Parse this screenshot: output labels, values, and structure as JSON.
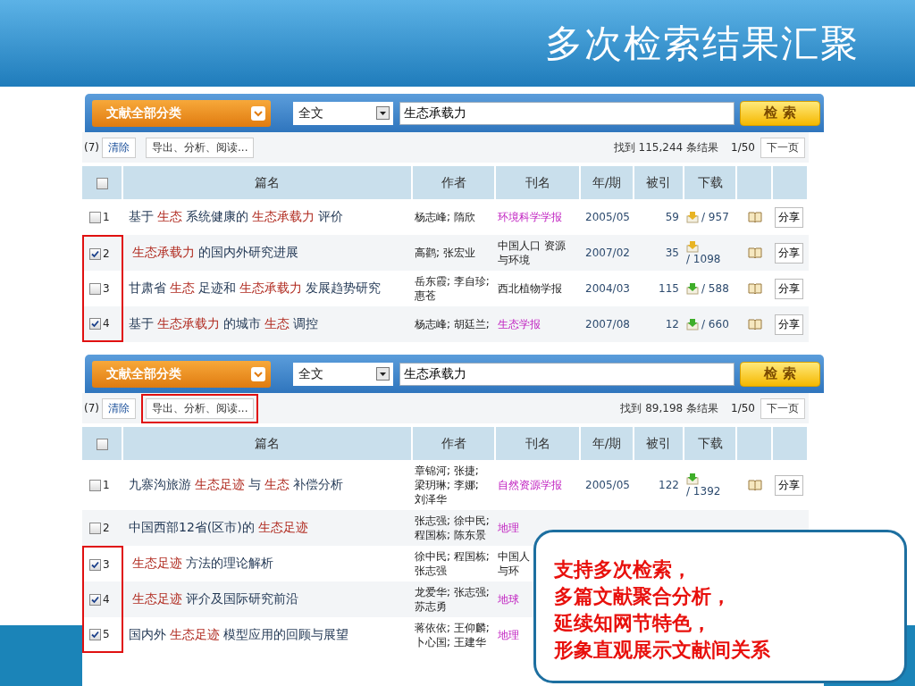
{
  "slide": {
    "title": "多次检索结果汇聚"
  },
  "panels": [
    {
      "search": {
        "category": "文献全部分类",
        "field": "全文",
        "query": "生态承载力",
        "button": "检 索"
      },
      "toolbar": {
        "count": "(7)",
        "clear": "清除",
        "export": {
          "label": "导出、分析、阅读...",
          "highlighted": false
        },
        "found": "找到 115,244 条结果",
        "page": "1/50",
        "next": "下一页"
      },
      "header_checked": false,
      "columns": [
        "篇名",
        "作者",
        "刊名",
        "年/期",
        "被引",
        "下载"
      ],
      "rows": [
        {
          "checked": false,
          "highlighted": false,
          "number": "1",
          "title": [
            {
              "text": "基于",
              "hit": false
            },
            {
              "text": "生态",
              "hit": true
            },
            {
              "text": "系统健康的",
              "hit": false
            },
            {
              "text": "生态承载力",
              "hit": true
            },
            {
              "text": "评价",
              "hit": false
            }
          ],
          "authors": "杨志峰; 隋欣",
          "journal": {
            "lines": [
              "环境科学学报"
            ],
            "linked": true
          },
          "year": "2005/05",
          "cited": "59",
          "download": {
            "count": "/ 957",
            "color": "#e8b423"
          },
          "share": "分享"
        },
        {
          "checked": true,
          "highlighted": true,
          "number": "2",
          "title": [
            {
              "text": "生态承载力",
              "hit": true
            },
            {
              "text": "的国内外研究进展",
              "hit": false
            }
          ],
          "authors": "高鹳; 张宏业",
          "journal": {
            "lines": [
              "中国人口 资源",
              "与环境"
            ],
            "linked": false
          },
          "year": "2007/02",
          "cited": "35",
          "download": {
            "count": "/ 1098",
            "color": "#e8b423"
          },
          "share": "分享"
        },
        {
          "checked": false,
          "highlighted": true,
          "number": "3",
          "title": [
            {
              "text": "甘肃省",
              "hit": false
            },
            {
              "text": "生态",
              "hit": true
            },
            {
              "text": "足迹和",
              "hit": false
            },
            {
              "text": "生态承载力",
              "hit": true
            },
            {
              "text": "发展趋势研究",
              "hit": false
            }
          ],
          "authors": "岳东霞; 李自珍;\n惠苍",
          "journal": {
            "lines": [
              "西北植物学报"
            ],
            "linked": false
          },
          "year": "2004/03",
          "cited": "115",
          "download": {
            "count": "/ 588",
            "color": "#3fae2a"
          },
          "share": "分享"
        },
        {
          "checked": true,
          "highlighted": true,
          "number": "4",
          "title": [
            {
              "text": "基于",
              "hit": false
            },
            {
              "text": "生态承载力",
              "hit": true
            },
            {
              "text": "的城市",
              "hit": false
            },
            {
              "text": "生态",
              "hit": true
            },
            {
              "text": "调控",
              "hit": false
            }
          ],
          "authors": "杨志峰; 胡廷兰;",
          "journal": {
            "lines": [
              "生态学报"
            ],
            "linked": true
          },
          "year": "2007/08",
          "cited": "12",
          "download": {
            "count": "/ 660",
            "color": "#3fae2a"
          },
          "share": "分享"
        }
      ]
    },
    {
      "search": {
        "category": "文献全部分类",
        "field": "全文",
        "query": "生态承载力",
        "button": "检 索"
      },
      "toolbar": {
        "count": "(7)",
        "clear": "清除",
        "export": {
          "label": "导出、分析、阅读...",
          "highlighted": true
        },
        "found": "找到 89,198 条结果",
        "page": "1/50",
        "next": "下一页"
      },
      "header_checked": false,
      "columns": [
        "篇名",
        "作者",
        "刊名",
        "年/期",
        "被引",
        "下载"
      ],
      "rows": [
        {
          "checked": false,
          "highlighted": false,
          "number": "1",
          "title": [
            {
              "text": "九寨沟旅游",
              "hit": false
            },
            {
              "text": "生态足迹",
              "hit": true
            },
            {
              "text": "与",
              "hit": false
            },
            {
              "text": "生态",
              "hit": true
            },
            {
              "text": "补偿分析",
              "hit": false
            }
          ],
          "authors": "章锦河; 张捷;\n梁玥琳; 李娜;\n刘泽华",
          "journal": {
            "lines": [
              "自然资源学报"
            ],
            "linked": true
          },
          "year": "2005/05",
          "cited": "122",
          "download": {
            "count": "/ 1392",
            "color": "#3fae2a"
          },
          "share": "分享"
        },
        {
          "checked": false,
          "highlighted": false,
          "number": "2",
          "title": [
            {
              "text": "中国西部12省(区市)的",
              "hit": false
            },
            {
              "text": "生态足迹",
              "hit": true
            }
          ],
          "authors": "张志强; 徐中民;\n程国栋; 陈东景",
          "journal": {
            "lines": [
              "地理"
            ],
            "linked": true
          }
        },
        {
          "checked": true,
          "highlighted": true,
          "number": "3",
          "title": [
            {
              "text": "生态足迹",
              "hit": true
            },
            {
              "text": "方法的理论解析",
              "hit": false
            }
          ],
          "authors": "徐中民; 程国栋;\n张志强",
          "journal": {
            "lines": [
              "中国人",
              "与环"
            ],
            "linked": false
          }
        },
        {
          "checked": true,
          "highlighted": true,
          "number": "4",
          "title": [
            {
              "text": "生态足迹",
              "hit": true
            },
            {
              "text": "评介及国际研究前沿",
              "hit": false
            }
          ],
          "authors": "龙爱华; 张志强;\n苏志勇",
          "journal": {
            "lines": [
              "地球"
            ],
            "linked": true
          }
        },
        {
          "checked": true,
          "highlighted": true,
          "number": "5",
          "title": [
            {
              "text": "国内外",
              "hit": false
            },
            {
              "text": "生态足迹",
              "hit": true
            },
            {
              "text": "模型应用的回顾与展望",
              "hit": false
            }
          ],
          "authors": "蒋依依; 王仰麟;\n卜心国; 王建华",
          "journal": {
            "lines": [
              "地理"
            ],
            "linked": true
          }
        }
      ]
    }
  ],
  "callout": {
    "lines": [
      "支持多次检索，",
      "多篇文献聚合分析，",
      "延续知网节特色，",
      "形象直观展示文献间关系"
    ]
  }
}
